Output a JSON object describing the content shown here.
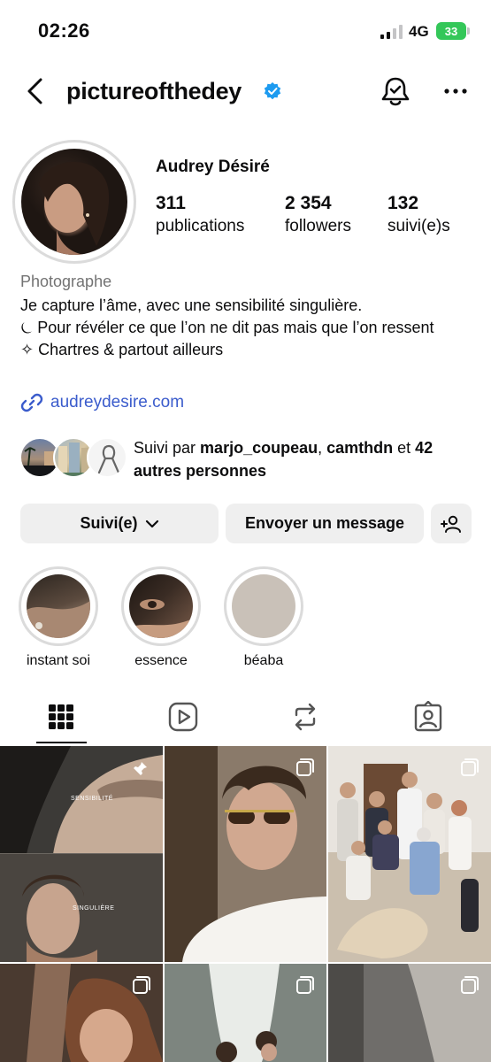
{
  "status_bar": {
    "time": "02:26",
    "network": "4G",
    "battery": "33"
  },
  "header": {
    "username": "pictureofthedey"
  },
  "profile": {
    "display_name": "Audrey Désiré",
    "stats": [
      {
        "value": "311",
        "label": "publications"
      },
      {
        "value": "2 354",
        "label": "followers"
      },
      {
        "value": "132",
        "label": "suivi(e)s"
      }
    ],
    "category": "Photographe",
    "bio_lines": [
      "Je capture l’âme, avec une sensibilité singulière.",
      "⏾ Pour révéler ce que l’on ne dit pas mais que l’on ressent",
      "✧ Chartres & partout ailleurs"
    ],
    "link": "audreydesire.com"
  },
  "followed_by": {
    "prefix": "Suivi par ",
    "user1": "marjo_coupeau",
    "separator": ", ",
    "user2": "camthdn",
    "connector": " et ",
    "others": "42 autres personnes"
  },
  "actions": {
    "follow_label": "Suivi(e)",
    "message_label": "Envoyer un message"
  },
  "highlights": [
    {
      "label": "instant soi"
    },
    {
      "label": "essence"
    },
    {
      "label": "béaba"
    }
  ],
  "posts": {
    "post1_text_top": "SENSIBILITÉ",
    "post1_text_bottom": "SINGULIÈRE"
  },
  "colors": {
    "link": "#3b5ccc",
    "verified": "#1d9bf0",
    "button_bg": "#efefef",
    "battery": "#34c759"
  }
}
